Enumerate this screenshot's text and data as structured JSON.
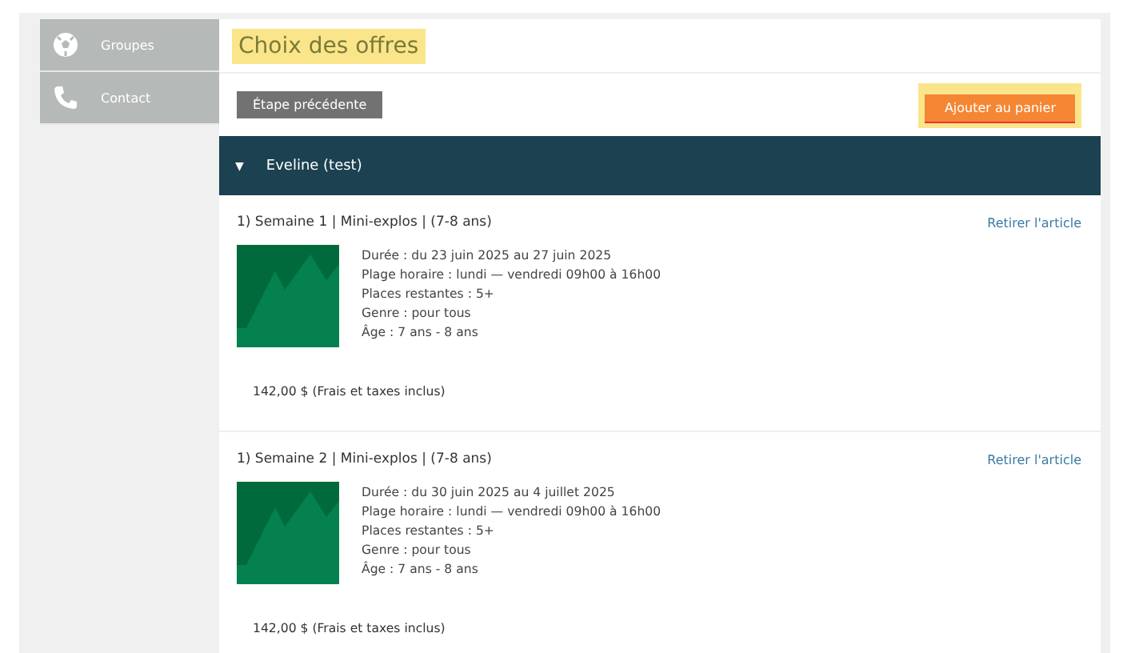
{
  "sidebar": {
    "items": [
      {
        "label": "Groupes"
      },
      {
        "label": "Contact"
      }
    ]
  },
  "page_title": "Choix des offres",
  "buttons": {
    "back": "Étape précédente",
    "add": "Ajouter au panier"
  },
  "participant": {
    "name": "Eveline (test)",
    "expanded": true,
    "toggle": "▼"
  },
  "offers": [
    {
      "title": "1) Semaine 1 | Mini-explos | (7-8 ans)",
      "remove": "Retirer l'article",
      "details": [
        "Durée : du 23 juin 2025 au 27 juin 2025",
        "Plage horaire : lundi — vendredi 09h00 à 16h00",
        "Places restantes : 5+",
        "Genre : pour tous",
        "Âge : 7 ans - 8 ans"
      ],
      "price": "142,00 $ (Frais et taxes inclus)"
    },
    {
      "title": "1) Semaine 2 | Mini-explos | (7-8 ans)",
      "remove": "Retirer l'article",
      "details": [
        "Durée : du 30 juin 2025 au 4 juillet 2025",
        "Plage horaire : lundi — vendredi 09h00 à 16h00",
        "Places restantes : 5+",
        "Genre : pour tous",
        "Âge : 7 ans - 8 ans"
      ],
      "price": "142,00 $ (Frais et taxes inclus)"
    }
  ]
}
